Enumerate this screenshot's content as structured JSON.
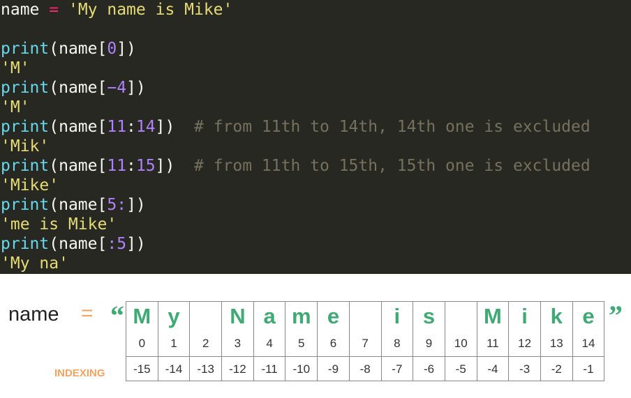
{
  "code": {
    "l1": {
      "a": "name ",
      "b": "=",
      "c": " ",
      "d": "'My name is Mike'"
    },
    "l3": {
      "a": "print",
      "b": "(name[",
      "c": "0",
      "d": "])"
    },
    "l4": "'M'",
    "l5": {
      "a": "print",
      "b": "(name[",
      "c": "−4",
      "d": "])"
    },
    "l6": "'M'",
    "l7": {
      "a": "print",
      "b": "(name[",
      "c": "11",
      "d": ":",
      "e": "14",
      "f": "])",
      "g": "  # from 11th to 14th, 14th one is excluded"
    },
    "l8": "'Mik'",
    "l9": {
      "a": "print",
      "b": "(name[",
      "c": "11",
      "d": ":",
      "e": "15",
      "f": "])",
      "g": "  # from 11th to 15th, 15th one is excluded"
    },
    "l10": "'Mike'",
    "l11": {
      "a": "print",
      "b": "(name[",
      "c": "5",
      "d": ":",
      "e": "])"
    },
    "l12": "'me is Mike'",
    "l13": {
      "a": "print",
      "b": "(name[",
      "c": ":",
      "d": "5",
      "e": "])"
    },
    "l14": "'My na'"
  },
  "diagram": {
    "name_label": "name",
    "equals": "=",
    "open_quote": "“",
    "close_quote": "”",
    "indexing_label": "INDEXING",
    "chars": [
      "M",
      "y",
      "",
      "N",
      "a",
      "m",
      "e",
      "",
      "i",
      "s",
      "",
      "M",
      "i",
      "k",
      "e"
    ],
    "positive": [
      "0",
      "1",
      "2",
      "3",
      "4",
      "5",
      "6",
      "7",
      "8",
      "9",
      "10",
      "11",
      "12",
      "13",
      "14"
    ],
    "negative": [
      "-15",
      "-14",
      "-13",
      "-12",
      "-11",
      "-10",
      "-9",
      "-8",
      "-7",
      "-6",
      "-5",
      "-4",
      "-3",
      "-2",
      "-1"
    ]
  }
}
